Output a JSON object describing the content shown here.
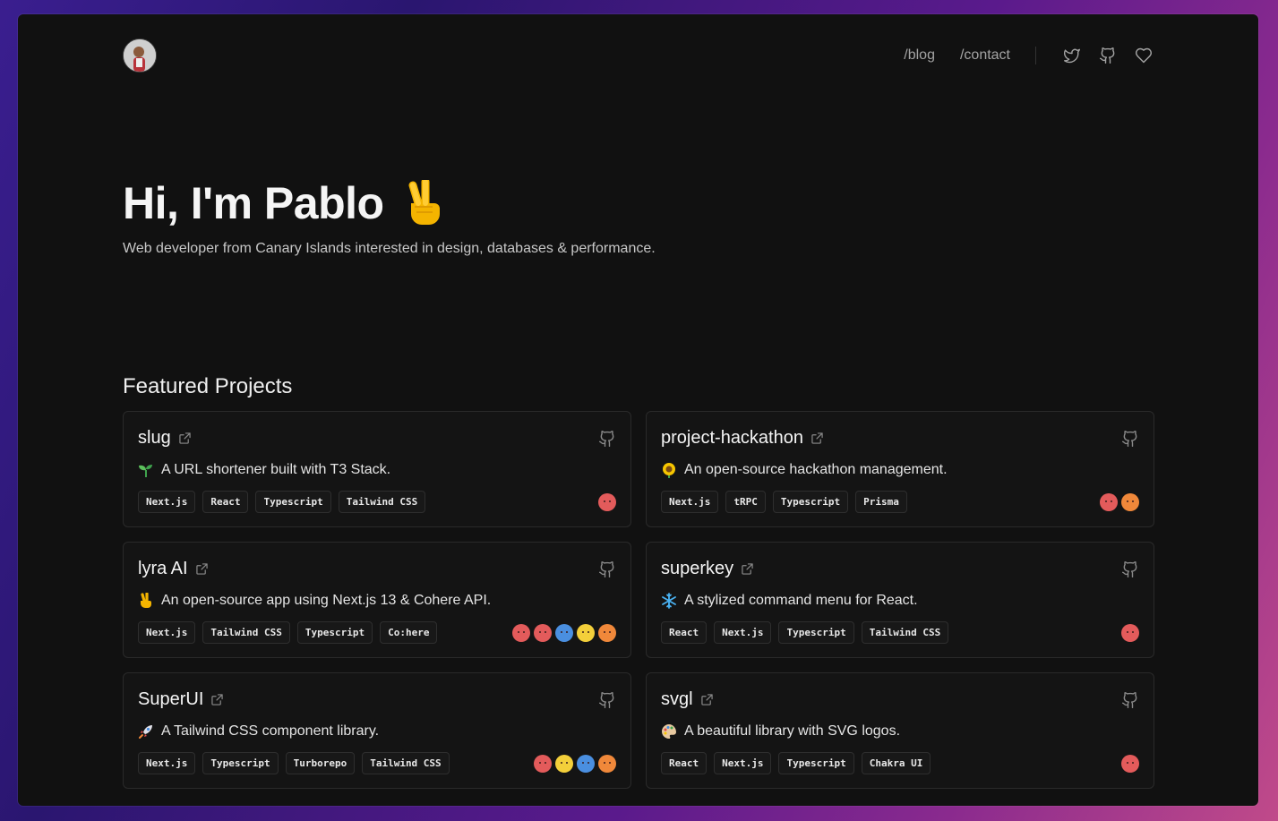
{
  "nav": {
    "links": [
      {
        "label": "/blog"
      },
      {
        "label": "/contact"
      }
    ],
    "icons": [
      "twitter-icon",
      "github-icon",
      "heart-icon"
    ]
  },
  "hero": {
    "title": "Hi, I'm Pablo",
    "emoji": "victory-hand",
    "subtitle": "Web developer from Canary Islands interested in design, databases & performance."
  },
  "projects": {
    "heading": "Featured Projects",
    "items": [
      {
        "name": "slug",
        "emoji": "seedling",
        "description": "A URL shortener built with T3 Stack.",
        "tags": [
          "Next.js",
          "React",
          "Typescript",
          "Tailwind CSS"
        ],
        "contributors": [
          "#e35b5b"
        ]
      },
      {
        "name": "project-hackathon",
        "emoji": "sunflower",
        "description": "An open-source hackathon management.",
        "tags": [
          "Next.js",
          "tRPC",
          "Typescript",
          "Prisma"
        ],
        "contributors": [
          "#e35b5b",
          "#f0883a"
        ]
      },
      {
        "name": "lyra AI",
        "emoji": "victory-hand",
        "description": "An open-source app using Next.js 13 & Cohere API.",
        "tags": [
          "Next.js",
          "Tailwind CSS",
          "Typescript",
          "Co:here"
        ],
        "contributors": [
          "#e35b5b",
          "#e35b5b",
          "#4a8fe0",
          "#f3cf3a",
          "#f0883a"
        ]
      },
      {
        "name": "superkey",
        "emoji": "snowflake",
        "description": "A stylized command menu for React.",
        "tags": [
          "React",
          "Next.js",
          "Typescript",
          "Tailwind CSS"
        ],
        "contributors": [
          "#e35b5b"
        ]
      },
      {
        "name": "SuperUI",
        "emoji": "rocket",
        "description": "A Tailwind CSS component library.",
        "tags": [
          "Next.js",
          "Typescript",
          "Turborepo",
          "Tailwind CSS"
        ],
        "contributors": [
          "#e35b5b",
          "#f3cf3a",
          "#4a8fe0",
          "#f0883a"
        ]
      },
      {
        "name": "svgl",
        "emoji": "artist-palette",
        "description": "A beautiful library with SVG logos.",
        "tags": [
          "React",
          "Next.js",
          "Typescript",
          "Chakra UI"
        ],
        "contributors": [
          "#e35b5b"
        ]
      }
    ]
  },
  "colors": {
    "background": "#111111",
    "text": "#f5f5f5",
    "muted": "#a3a3a3",
    "border": "#2a2a2a"
  }
}
